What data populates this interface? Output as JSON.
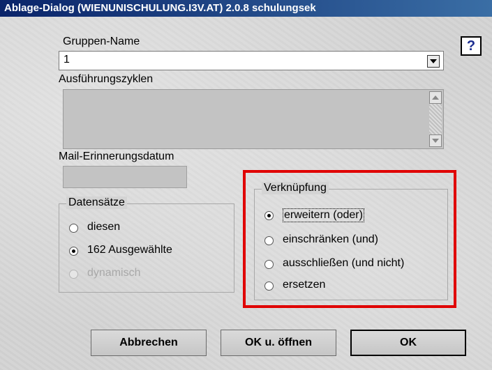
{
  "window": {
    "title": "Ablage-Dialog  (WIENUNISCHULUNG.I3V.AT)  2.0.8  schulungsek"
  },
  "help": {
    "label": "?"
  },
  "gruppen": {
    "label": "Gruppen-Name",
    "value": "1"
  },
  "zyklen": {
    "label": "Ausführungszyklen",
    "value": ""
  },
  "mail": {
    "label": "Mail-Erinnerungsdatum",
    "value": ""
  },
  "datensaetze": {
    "title": "Datensätze",
    "options": [
      {
        "label": "diesen",
        "checked": false,
        "enabled": true
      },
      {
        "label": "162 Ausgewählte",
        "checked": true,
        "enabled": true
      },
      {
        "label": "dynamisch",
        "checked": false,
        "enabled": false
      }
    ]
  },
  "verknuepfung": {
    "title": "Verknüpfung",
    "options": [
      {
        "label": "erweitern (oder)",
        "checked": true,
        "focused": true
      },
      {
        "label": "einschränken (und)",
        "checked": false
      },
      {
        "label": "ausschließen (und nicht)",
        "checked": false
      },
      {
        "label": "ersetzen",
        "checked": false
      }
    ],
    "highlight_color": "#e00000"
  },
  "buttons": {
    "cancel": "Abbrechen",
    "ok_open": "OK u. öffnen",
    "ok": "OK"
  },
  "colors": {
    "titlebar_start": "#0a246a",
    "titlebar_end": "#3a6ea5",
    "help_icon": "#1a2c8f"
  }
}
